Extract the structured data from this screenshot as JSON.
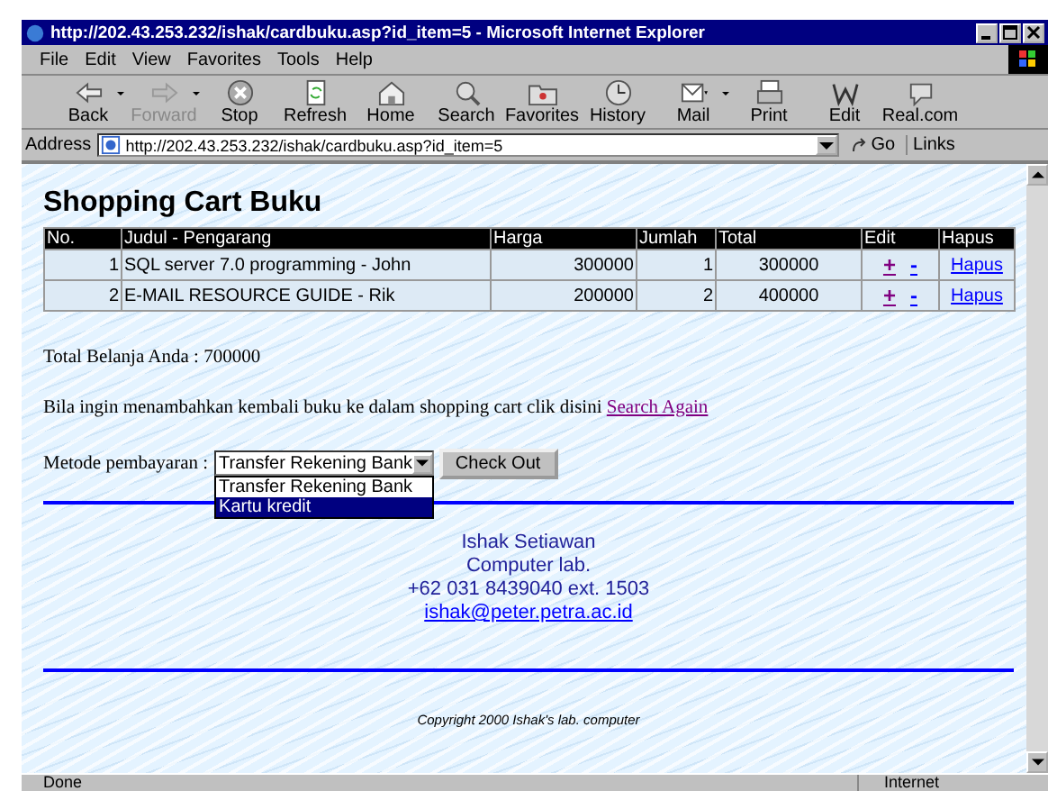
{
  "window": {
    "title": "http://202.43.253.232/ishak/cardbuku.asp?id_item=5 - Microsoft Internet Explorer"
  },
  "menu": [
    "File",
    "Edit",
    "View",
    "Favorites",
    "Tools",
    "Help"
  ],
  "toolbar": [
    {
      "label": "Back",
      "disabled": false,
      "dropdown": true
    },
    {
      "label": "Forward",
      "disabled": true,
      "dropdown": true
    },
    {
      "label": "Stop",
      "disabled": false,
      "dropdown": false
    },
    {
      "label": "Refresh",
      "disabled": false,
      "dropdown": false
    },
    {
      "label": "Home",
      "disabled": false,
      "dropdown": false
    },
    {
      "label": "Search",
      "disabled": false,
      "dropdown": false
    },
    {
      "label": "Favorites",
      "disabled": false,
      "dropdown": false
    },
    {
      "label": "History",
      "disabled": false,
      "dropdown": false
    },
    {
      "label": "Mail",
      "disabled": false,
      "dropdown": true
    },
    {
      "label": "Print",
      "disabled": false,
      "dropdown": false
    },
    {
      "label": "Edit",
      "disabled": false,
      "dropdown": false
    },
    {
      "label": "Real.com",
      "disabled": false,
      "dropdown": false
    }
  ],
  "address": {
    "label": "Address",
    "value": "http://202.43.253.232/ishak/cardbuku.asp?id_item=5",
    "go": "Go",
    "links": "Links"
  },
  "page": {
    "heading": "Shopping Cart Buku",
    "table": {
      "columns": [
        "No.",
        "Judul - Pengarang",
        "Harga",
        "Jumlah",
        "Total",
        "Edit",
        "Hapus"
      ],
      "rows": [
        {
          "no": "1",
          "title": "SQL server 7.0 programming - John",
          "price": "300000",
          "qty": "1",
          "total": "300000",
          "plus": "+",
          "minus": "-",
          "delete": "Hapus"
        },
        {
          "no": "2",
          "title": "E-MAIL RESOURCE GUIDE - Rik",
          "price": "200000",
          "qty": "2",
          "total": "400000",
          "plus": "+",
          "minus": "-",
          "delete": "Hapus"
        }
      ]
    },
    "total_text": "Total Belanja Anda : 700000",
    "search_text": "Bila ingin menambahkan kembali buku ke dalam shopping cart clik disini",
    "search_link": "Search Again",
    "payment_label": "Metode pembayaran :",
    "payment_select": {
      "value": "Transfer Rekening Bank",
      "options": [
        {
          "label": "Transfer Rekening Bank",
          "highlighted": false
        },
        {
          "label": "Kartu kredit",
          "highlighted": true
        }
      ]
    },
    "checkout_button": "Check Out",
    "contact": [
      "Ishak Setiawan",
      "Computer lab.",
      "+62 031 8439040 ext. 1503"
    ],
    "email": "ishak@peter.petra.ac.id",
    "copyright": "Copyright 2000 Ishak's lab. computer"
  },
  "status_bar": {
    "text": "Done",
    "zone": "Internet"
  }
}
